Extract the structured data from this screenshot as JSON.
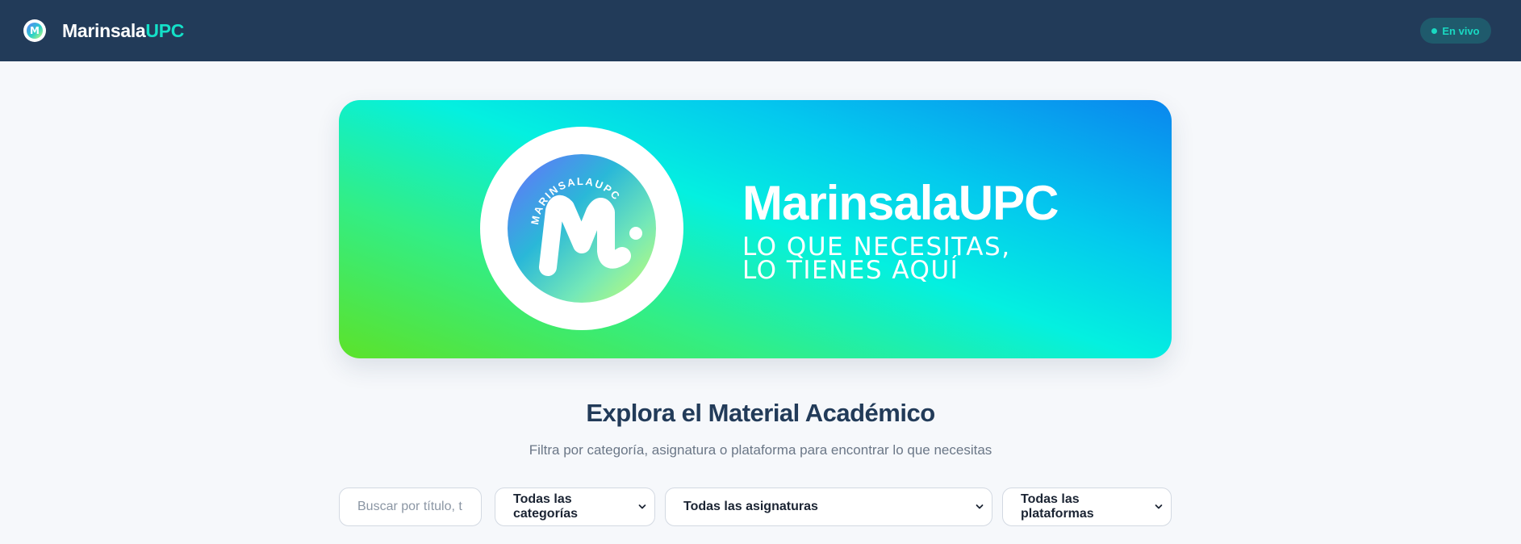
{
  "header": {
    "brand_part1": "Marinsala",
    "brand_part2": "UPC",
    "status_label": "En vivo",
    "logo_letter": "M"
  },
  "hero": {
    "title": "MarinsalaUPC",
    "tagline_line1": "LO QUE NECESITAS,",
    "tagline_line2": "LO TIENES AQUÍ",
    "logo_ring_text": "MARINSALAUPC"
  },
  "section": {
    "title": "Explora el Material Académico",
    "subtitle": "Filtra por categoría, asignatura o plataforma para encontrar lo que necesitas"
  },
  "filters": {
    "search_placeholder": "Buscar por título, t",
    "category_selected": "Todas las categorías",
    "subject_selected": "Todas las asignaturas",
    "platform_selected": "Todas las plataformas"
  },
  "colors": {
    "header_bg": "#223b59",
    "accent": "#14e0c8",
    "page_bg": "#f6f8fb"
  }
}
